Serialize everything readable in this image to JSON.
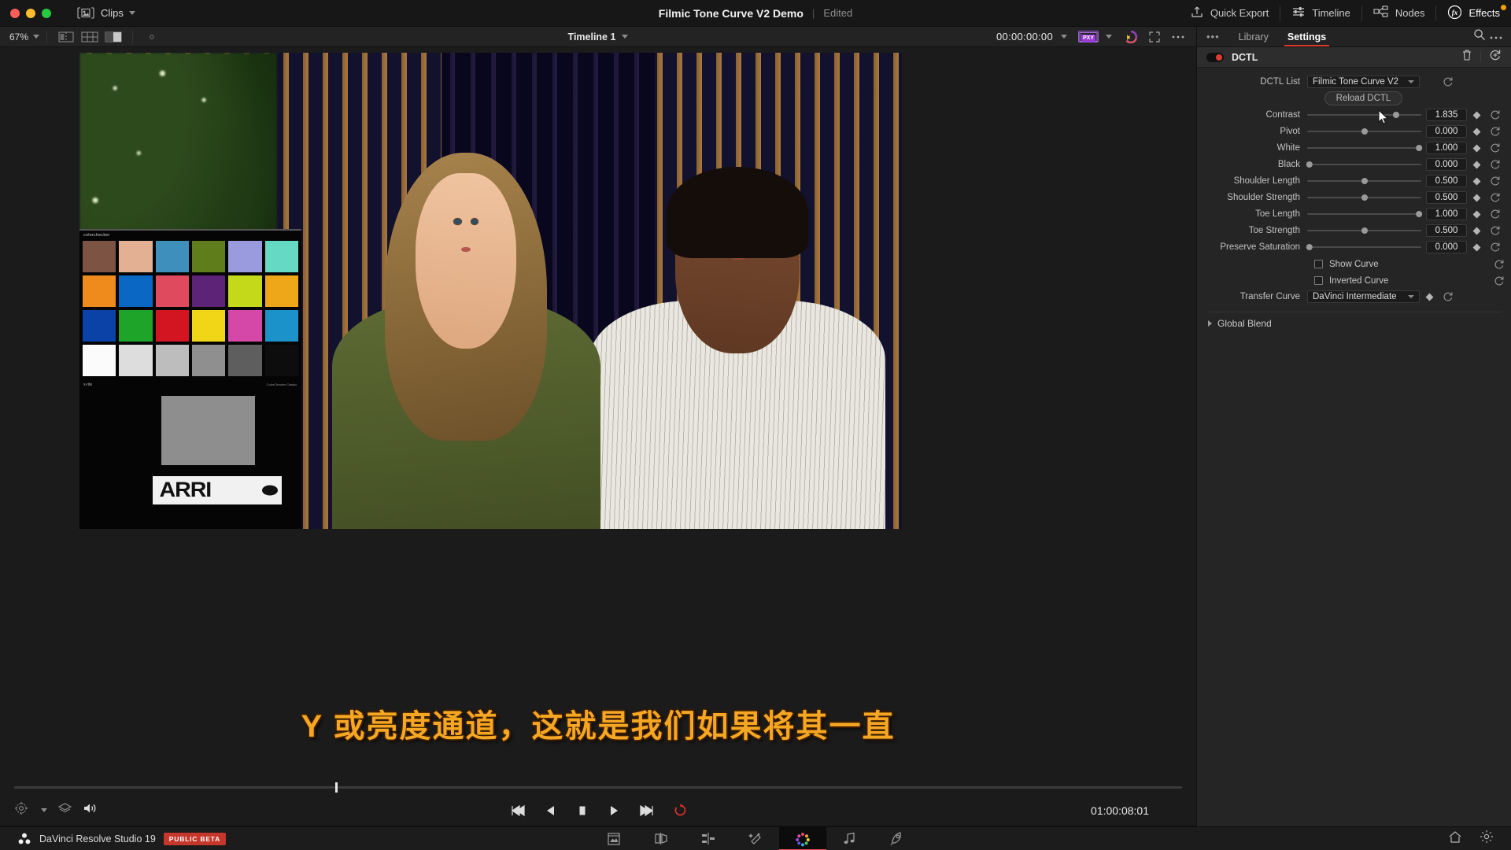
{
  "titlebar": {
    "clips_label": "Clips",
    "project_title": "Filmic Tone Curve V2 Demo",
    "separator": "|",
    "edited_status": "Edited",
    "buttons": [
      {
        "label": "Quick Export",
        "icon": "export-icon"
      },
      {
        "label": "Timeline",
        "icon": "timeline-icon"
      },
      {
        "label": "Nodes",
        "icon": "nodes-icon"
      },
      {
        "label": "Effects",
        "icon": "fx-icon"
      }
    ]
  },
  "viewer_toolbar": {
    "zoom_level": "67%",
    "timeline_name": "Timeline 1",
    "timecode": "00:00:00:00",
    "proxy_badge": "PXY",
    "icons": [
      "split-view-icon",
      "grid-view-icon",
      "wipe-view-icon",
      "onscreen-control-icon",
      "color-wheel-icon",
      "fullscreen-icon",
      "more-options-icon"
    ]
  },
  "viewer": {
    "subtitle_text": "Y 或亮度通道，这就是我们如果将其一直",
    "chart_label": "colorchecker",
    "chart_brand": "x-rite",
    "chart_footer": "ColorChecker Classic",
    "logo_text": "ARRI",
    "colorchecker_patches": [
      "#7d5344",
      "#e4b093",
      "#3f8fbd",
      "#5f7d1a",
      "#9a9ade",
      "#66d9c4",
      "#ef8b1c",
      "#0b67c4",
      "#e04a5e",
      "#5c2377",
      "#c4d91a",
      "#efa71a",
      "#0b42a8",
      "#1fa42a",
      "#d21520",
      "#f0d617",
      "#d648a8",
      "#1b92c9",
      "#fbfbfb",
      "#dddddd",
      "#bdbdbd",
      "#8f8f8f",
      "#5e5e5e",
      "#0d0d0d"
    ]
  },
  "transport": {
    "buttons": [
      "jump-to-start",
      "step-back",
      "stop",
      "play",
      "jump-to-end",
      "loop"
    ],
    "left_icons": [
      "onscreen-controls-icon",
      "layers-icon",
      "audio-icon"
    ],
    "timecode": "01:00:08:01",
    "playhead_percent": 27.5
  },
  "inspector": {
    "tabs": [
      {
        "label": "Library",
        "active": false
      },
      {
        "label": "Settings",
        "active": true
      }
    ],
    "more_label": "•••",
    "search_icon": "search-icon",
    "options_icon": "more-options-icon",
    "effect": {
      "name": "DCTL",
      "enabled": true,
      "delete_icon": "trash-icon",
      "reset_icon": "reset-all-icon"
    },
    "dctl_list": {
      "label": "DCTL List",
      "value": "Filmic Tone Curve V2"
    },
    "reload_button": "Reload DCTL",
    "parameters": [
      {
        "label": "Contrast",
        "value": "1.835",
        "slider": 0.78
      },
      {
        "label": "Pivot",
        "value": "0.000",
        "slider": 0.5
      },
      {
        "label": "White",
        "value": "1.000",
        "slider": 1.0
      },
      {
        "label": "Black",
        "value": "0.000",
        "slider": 0.0
      },
      {
        "label": "Shoulder Length",
        "value": "0.500",
        "slider": 0.5
      },
      {
        "label": "Shoulder Strength",
        "value": "0.500",
        "slider": 0.5
      },
      {
        "label": "Toe Length",
        "value": "1.000",
        "slider": 1.0
      },
      {
        "label": "Toe Strength",
        "value": "0.500",
        "slider": 0.5
      },
      {
        "label": "Preserve Saturation",
        "value": "0.000",
        "slider": 0.0
      }
    ],
    "checkboxes": [
      {
        "label": "Show Curve",
        "checked": false
      },
      {
        "label": "Inverted Curve",
        "checked": false
      }
    ],
    "transfer_curve": {
      "label": "Transfer Curve",
      "value": "DaVinci Intermediate"
    },
    "global_blend": "Global Blend"
  },
  "bottombar": {
    "app_name": "DaVinci Resolve Studio 19",
    "beta_badge": "PUBLIC BETA",
    "pages": [
      {
        "name": "media-page",
        "active": false
      },
      {
        "name": "cut-page",
        "active": false
      },
      {
        "name": "edit-page",
        "active": false
      },
      {
        "name": "fusion-page",
        "active": false
      },
      {
        "name": "color-page",
        "active": true
      },
      {
        "name": "fairlight-page",
        "active": false
      },
      {
        "name": "deliver-page",
        "active": false
      }
    ],
    "right_icons": [
      "home-icon",
      "project-settings-icon"
    ]
  },
  "colors": {
    "accent_red": "#d93b2b",
    "subtitle_orange": "#f5a623",
    "beta_red": "#c5362b",
    "toggle_red": "#e03b2f"
  }
}
